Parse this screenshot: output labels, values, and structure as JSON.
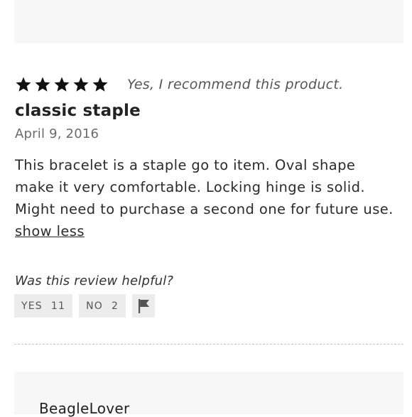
{
  "review": {
    "rating": 5,
    "rating_max": 5,
    "recommend_text": "Yes, I recommend this product.",
    "title": "classic staple",
    "date": "April 9, 2016",
    "body": "This bracelet is a staple go to item. Oval shape make it very comfortable. Locking hinge is solid. Might need to purchase a second one for future use.",
    "toggle_label": "show less"
  },
  "helpful": {
    "question": "Was this review helpful?",
    "yes_label": "YES",
    "yes_count": "11",
    "no_label": "NO",
    "no_count": "2",
    "flag_icon": "flag-icon"
  },
  "next_review": {
    "author": "BeagleLover"
  },
  "colors": {
    "panel_bg": "#f7f7f7",
    "button_bg": "#ececec",
    "star": "#111111"
  }
}
